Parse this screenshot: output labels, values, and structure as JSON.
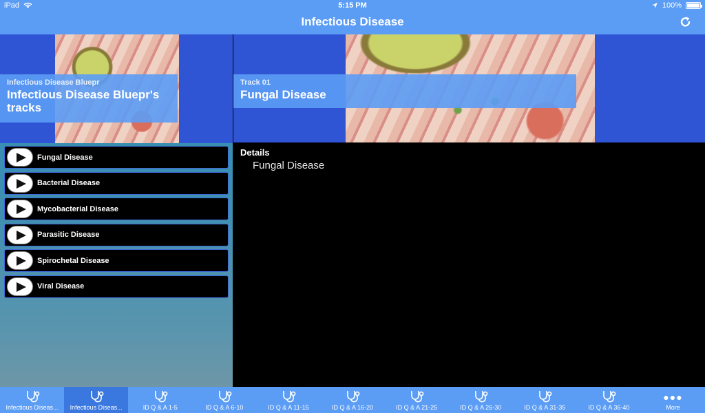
{
  "status": {
    "device": "iPad",
    "time": "5:15 PM",
    "battery": "100%"
  },
  "nav": {
    "title": "Infectious Disease"
  },
  "left_hero": {
    "subtitle": "Infectious Disease Bluepr",
    "title": "Infectious Disease Bluepr's tracks"
  },
  "tracks": [
    {
      "label": "Fungal Disease"
    },
    {
      "label": "Bacterial Disease"
    },
    {
      "label": "Mycobacterial Disease"
    },
    {
      "label": "Parasitic Disease"
    },
    {
      "label": "Spirochetal Disease"
    },
    {
      "label": "Viral Disease"
    }
  ],
  "right_hero": {
    "subtitle": "Track 01",
    "title": "Fungal Disease"
  },
  "details": {
    "title": "Details",
    "body": "Fungal Disease"
  },
  "tabs": [
    {
      "label": "Infectious Diseas...",
      "icon": "stethoscope-icon",
      "active": false
    },
    {
      "label": "Infectious Diseas...",
      "icon": "stethoscope-icon",
      "active": true
    },
    {
      "label": "ID Q & A 1-5",
      "icon": "stethoscope-icon",
      "active": false
    },
    {
      "label": "ID Q & A 6-10",
      "icon": "stethoscope-icon",
      "active": false
    },
    {
      "label": "ID Q & A 11-15",
      "icon": "stethoscope-icon",
      "active": false
    },
    {
      "label": "ID Q & A 16-20",
      "icon": "stethoscope-icon",
      "active": false
    },
    {
      "label": "ID Q & A 21-25",
      "icon": "stethoscope-icon",
      "active": false
    },
    {
      "label": "ID Q & A 26-30",
      "icon": "stethoscope-icon",
      "active": false
    },
    {
      "label": "ID Q & A 31-35",
      "icon": "stethoscope-icon",
      "active": false
    },
    {
      "label": "ID Q & A 36-40",
      "icon": "stethoscope-icon",
      "active": false
    },
    {
      "label": "More",
      "icon": "more-dots-icon",
      "active": false
    }
  ],
  "colors": {
    "bar": "#5b9cf5",
    "active_tab": "#3a78e0",
    "hero_bg": "#2f55d4"
  }
}
